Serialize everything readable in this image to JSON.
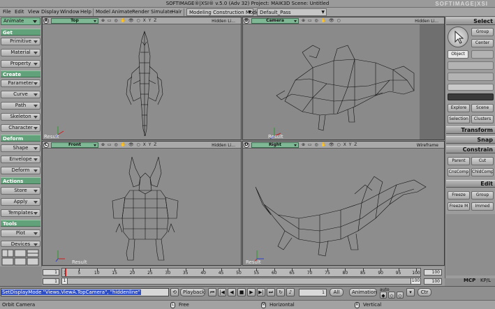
{
  "app": {
    "title": "SOFTIMAGE®|XSI® v.5.0 (Adv 32) Project: MAIK3D   Scene: Untitled",
    "logo": "SOFTIMAGE|XSI"
  },
  "menubar": {
    "items": [
      "File",
      "Edit",
      "View",
      "Display",
      "Window",
      "Help"
    ],
    "modules": [
      "Model",
      "Animate",
      "Render",
      "Simulate",
      "Hair"
    ],
    "mode_dropdown": "Modeling Construction Mode",
    "pass_dropdown": "Default_Pass"
  },
  "left_panel": {
    "top_dropdown": "Animate",
    "sections": [
      {
        "header": "Get",
        "buttons": [
          "Primitive",
          "Material",
          "Property"
        ]
      },
      {
        "header": "Create",
        "buttons": [
          "Parameter",
          "Curve",
          "Path",
          "Skeleton",
          "Character"
        ]
      },
      {
        "header": "Deform",
        "buttons": [
          "Shape",
          "Envelope",
          "Deform"
        ]
      },
      {
        "header": "Actions",
        "buttons": [
          "Store",
          "Apply",
          "Templates"
        ]
      },
      {
        "header": "Tools",
        "buttons": [
          "Plot",
          "Devices"
        ]
      }
    ]
  },
  "viewports": [
    {
      "letter": "A",
      "camera": "Top",
      "mode": "Hidden Li...",
      "label": "Result",
      "icons": "⊕ ▭ ◎ ✋ 👁 ○ X Y Z"
    },
    {
      "letter": "B",
      "camera": "Camera",
      "mode": "Hidden Li...",
      "label": "Result",
      "icons": "⊕ ▭ ◎ ✋ 👁 ○"
    },
    {
      "letter": "C",
      "camera": "Front",
      "mode": "Hidden Li...",
      "label": "Result",
      "icons": "⊕ ▭ ◎ ✋ 👁 ○ X Y Z"
    },
    {
      "letter": "D",
      "camera": "Right",
      "mode": "Wireframe",
      "label": "Result",
      "icons": "⊕ ▭ ◎ ✋ 👁 ○ X Y Z"
    }
  ],
  "right_panel": {
    "headers": {
      "select": "Select",
      "transform": "Transform",
      "snap": "Snap",
      "constrain": "Constrain",
      "edit": "Edit"
    },
    "select_buttons": {
      "group": "Group",
      "center": "Center",
      "object": "Object"
    },
    "explore_buttons": [
      "Explore",
      "Scene",
      "Selection",
      "Clusters"
    ],
    "constrain_buttons": [
      "Parent",
      "Cut",
      "CnsComp",
      "ChldComp"
    ],
    "edit_buttons": [
      "Freeze",
      "Group",
      "Freeze M",
      "Immed"
    ]
  },
  "timeline": {
    "start_top": "1",
    "start_bottom": "1",
    "end_top": "100",
    "end_bottom": "100",
    "ruler_ticks": [
      "1",
      "5",
      "10",
      "15",
      "20",
      "25",
      "30",
      "35",
      "40",
      "45",
      "50",
      "55",
      "60",
      "65",
      "70",
      "75",
      "80",
      "85",
      "90",
      "95",
      "100"
    ],
    "current_frame": 1,
    "scrub_right_value": "100"
  },
  "command_row": {
    "command_text": "SetDisplayMode \"Views.ViewA.TopCamera\", \"hiddenline\"",
    "playback_label": "Playback",
    "frame_field": "1",
    "all_label": "All",
    "animation_label": "Animation",
    "auto_label": "auto",
    "ctr_label": "Ctr",
    "mcp_tab": "MCP",
    "kpl_tab": "KP/L"
  },
  "status_bar": {
    "tool": "Orbit Camera",
    "left_mouse": "Free",
    "middle_mouse": "Horizontal",
    "right_mouse": "Vertical"
  }
}
